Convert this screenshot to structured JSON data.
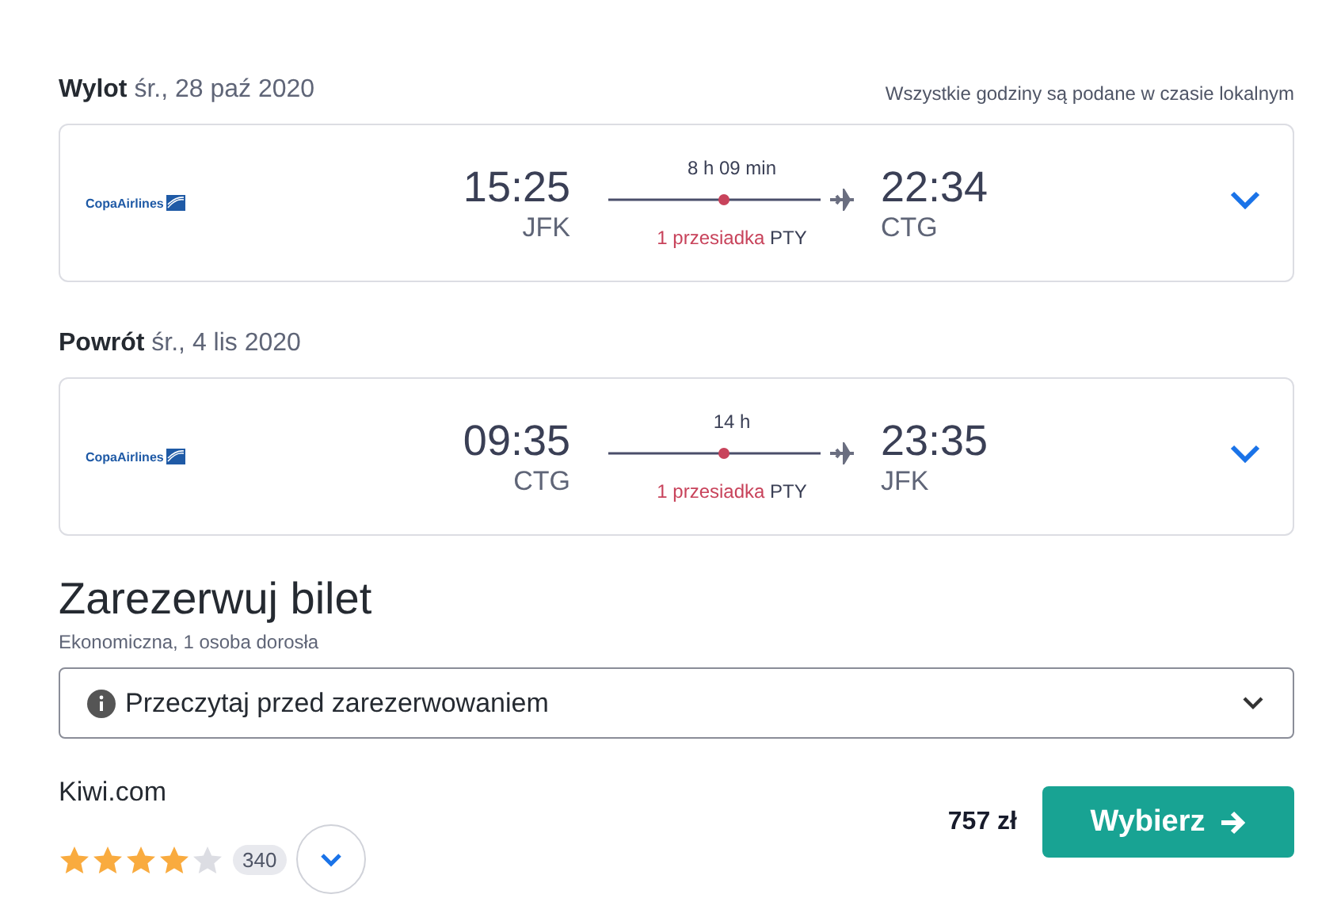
{
  "legs": [
    {
      "label": "Wylot",
      "date": "śr., 28 paź 2020",
      "note": "Wszystkie godziny są podane w czasie lokalnym",
      "airline": "CopaAirlines",
      "dep_time": "15:25",
      "dep_code": "JFK",
      "duration": "8 h 09 min",
      "arr_time": "22:34",
      "arr_code": "CTG",
      "stops": "1 przesiadka",
      "via": "PTY",
      "expanded": false
    },
    {
      "label": "Powrót",
      "date": "śr., 4 lis 2020",
      "airline": "CopaAirlines",
      "dep_time": "09:35",
      "dep_code": "CTG",
      "duration": "14 h",
      "arr_time": "23:35",
      "arr_code": "JFK",
      "stops": "1 przesiadka",
      "via": "PTY",
      "expanded": false
    }
  ],
  "booking": {
    "title": "Zarezerwuj bilet",
    "subtitle": "Ekonomiczna, 1 osoba dorosła",
    "notice": "Przeczytaj przed zarezerwowaniem",
    "notice_expanded": false
  },
  "offer": {
    "provider": "Kiwi.com",
    "stars": 4,
    "reviews": "340",
    "price": "757 zł",
    "button": "Wybierz"
  }
}
